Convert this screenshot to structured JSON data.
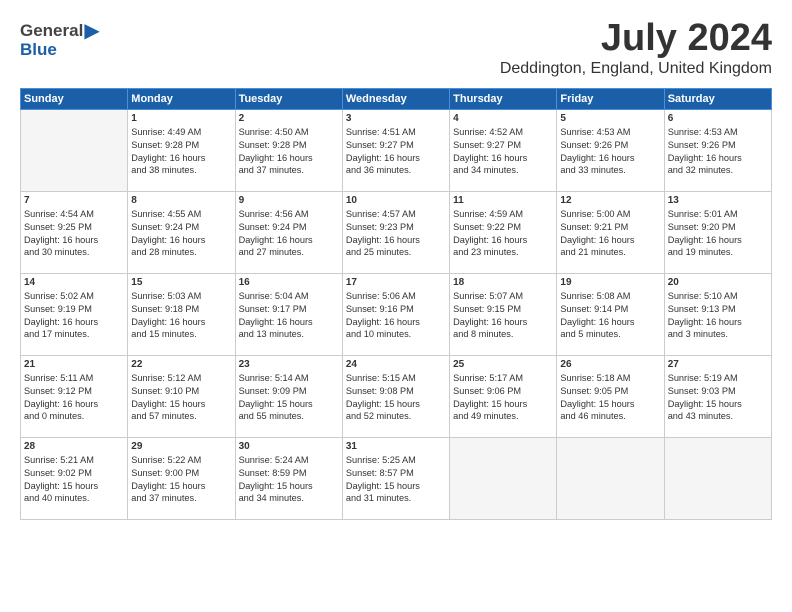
{
  "logo": {
    "general": "General",
    "blue": "Blue"
  },
  "title": {
    "month": "July 2024",
    "location": "Deddington, England, United Kingdom"
  },
  "days_of_week": [
    "Sunday",
    "Monday",
    "Tuesday",
    "Wednesday",
    "Thursday",
    "Friday",
    "Saturday"
  ],
  "weeks": [
    [
      {
        "day": "",
        "info": ""
      },
      {
        "day": "1",
        "info": "Sunrise: 4:49 AM\nSunset: 9:28 PM\nDaylight: 16 hours\nand 38 minutes."
      },
      {
        "day": "2",
        "info": "Sunrise: 4:50 AM\nSunset: 9:28 PM\nDaylight: 16 hours\nand 37 minutes."
      },
      {
        "day": "3",
        "info": "Sunrise: 4:51 AM\nSunset: 9:27 PM\nDaylight: 16 hours\nand 36 minutes."
      },
      {
        "day": "4",
        "info": "Sunrise: 4:52 AM\nSunset: 9:27 PM\nDaylight: 16 hours\nand 34 minutes."
      },
      {
        "day": "5",
        "info": "Sunrise: 4:53 AM\nSunset: 9:26 PM\nDaylight: 16 hours\nand 33 minutes."
      },
      {
        "day": "6",
        "info": "Sunrise: 4:53 AM\nSunset: 9:26 PM\nDaylight: 16 hours\nand 32 minutes."
      }
    ],
    [
      {
        "day": "7",
        "info": "Sunrise: 4:54 AM\nSunset: 9:25 PM\nDaylight: 16 hours\nand 30 minutes."
      },
      {
        "day": "8",
        "info": "Sunrise: 4:55 AM\nSunset: 9:24 PM\nDaylight: 16 hours\nand 28 minutes."
      },
      {
        "day": "9",
        "info": "Sunrise: 4:56 AM\nSunset: 9:24 PM\nDaylight: 16 hours\nand 27 minutes."
      },
      {
        "day": "10",
        "info": "Sunrise: 4:57 AM\nSunset: 9:23 PM\nDaylight: 16 hours\nand 25 minutes."
      },
      {
        "day": "11",
        "info": "Sunrise: 4:59 AM\nSunset: 9:22 PM\nDaylight: 16 hours\nand 23 minutes."
      },
      {
        "day": "12",
        "info": "Sunrise: 5:00 AM\nSunset: 9:21 PM\nDaylight: 16 hours\nand 21 minutes."
      },
      {
        "day": "13",
        "info": "Sunrise: 5:01 AM\nSunset: 9:20 PM\nDaylight: 16 hours\nand 19 minutes."
      }
    ],
    [
      {
        "day": "14",
        "info": "Sunrise: 5:02 AM\nSunset: 9:19 PM\nDaylight: 16 hours\nand 17 minutes."
      },
      {
        "day": "15",
        "info": "Sunrise: 5:03 AM\nSunset: 9:18 PM\nDaylight: 16 hours\nand 15 minutes."
      },
      {
        "day": "16",
        "info": "Sunrise: 5:04 AM\nSunset: 9:17 PM\nDaylight: 16 hours\nand 13 minutes."
      },
      {
        "day": "17",
        "info": "Sunrise: 5:06 AM\nSunset: 9:16 PM\nDaylight: 16 hours\nand 10 minutes."
      },
      {
        "day": "18",
        "info": "Sunrise: 5:07 AM\nSunset: 9:15 PM\nDaylight: 16 hours\nand 8 minutes."
      },
      {
        "day": "19",
        "info": "Sunrise: 5:08 AM\nSunset: 9:14 PM\nDaylight: 16 hours\nand 5 minutes."
      },
      {
        "day": "20",
        "info": "Sunrise: 5:10 AM\nSunset: 9:13 PM\nDaylight: 16 hours\nand 3 minutes."
      }
    ],
    [
      {
        "day": "21",
        "info": "Sunrise: 5:11 AM\nSunset: 9:12 PM\nDaylight: 16 hours\nand 0 minutes."
      },
      {
        "day": "22",
        "info": "Sunrise: 5:12 AM\nSunset: 9:10 PM\nDaylight: 15 hours\nand 57 minutes."
      },
      {
        "day": "23",
        "info": "Sunrise: 5:14 AM\nSunset: 9:09 PM\nDaylight: 15 hours\nand 55 minutes."
      },
      {
        "day": "24",
        "info": "Sunrise: 5:15 AM\nSunset: 9:08 PM\nDaylight: 15 hours\nand 52 minutes."
      },
      {
        "day": "25",
        "info": "Sunrise: 5:17 AM\nSunset: 9:06 PM\nDaylight: 15 hours\nand 49 minutes."
      },
      {
        "day": "26",
        "info": "Sunrise: 5:18 AM\nSunset: 9:05 PM\nDaylight: 15 hours\nand 46 minutes."
      },
      {
        "day": "27",
        "info": "Sunrise: 5:19 AM\nSunset: 9:03 PM\nDaylight: 15 hours\nand 43 minutes."
      }
    ],
    [
      {
        "day": "28",
        "info": "Sunrise: 5:21 AM\nSunset: 9:02 PM\nDaylight: 15 hours\nand 40 minutes."
      },
      {
        "day": "29",
        "info": "Sunrise: 5:22 AM\nSunset: 9:00 PM\nDaylight: 15 hours\nand 37 minutes."
      },
      {
        "day": "30",
        "info": "Sunrise: 5:24 AM\nSunset: 8:59 PM\nDaylight: 15 hours\nand 34 minutes."
      },
      {
        "day": "31",
        "info": "Sunrise: 5:25 AM\nSunset: 8:57 PM\nDaylight: 15 hours\nand 31 minutes."
      },
      {
        "day": "",
        "info": ""
      },
      {
        "day": "",
        "info": ""
      },
      {
        "day": "",
        "info": ""
      }
    ]
  ]
}
